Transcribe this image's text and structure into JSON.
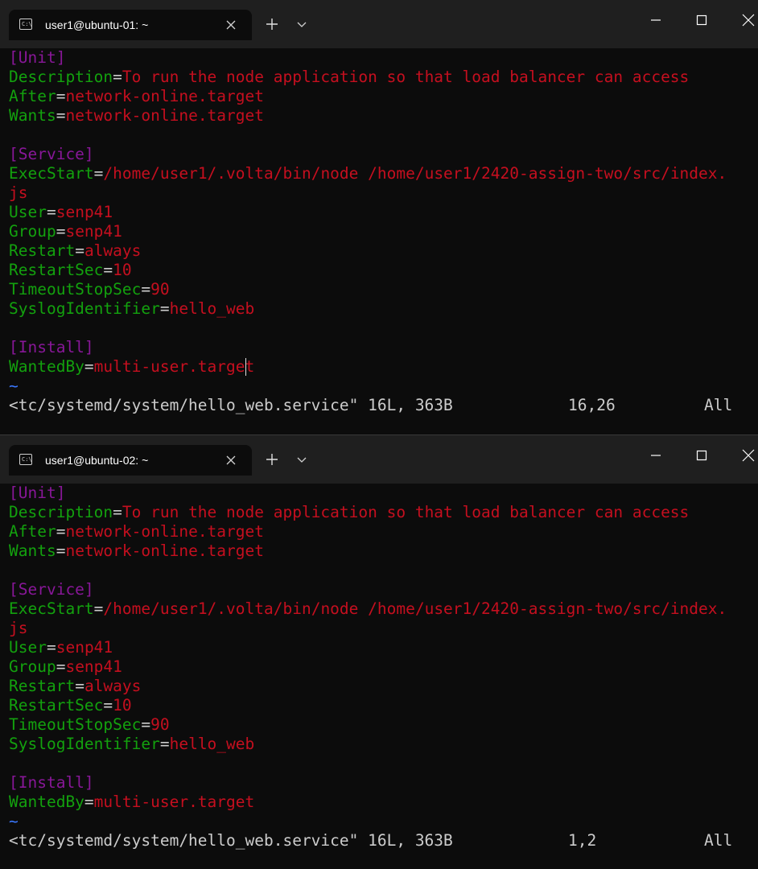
{
  "windows": [
    {
      "tab_title": "user1@ubuntu-01: ~",
      "lines": [
        [
          [
            "sec",
            "[Unit]"
          ]
        ],
        [
          [
            "key",
            "Description"
          ],
          [
            "eq",
            "="
          ],
          [
            "val",
            "To run the node application so that load balancer can access"
          ]
        ],
        [
          [
            "key",
            "After"
          ],
          [
            "eq",
            "="
          ],
          [
            "val",
            "network-online.target"
          ]
        ],
        [
          [
            "key",
            "Wants"
          ],
          [
            "eq",
            "="
          ],
          [
            "val",
            "network-online.target"
          ]
        ],
        [],
        [
          [
            "sec",
            "[Service]"
          ]
        ],
        [
          [
            "key",
            "ExecStart"
          ],
          [
            "eq",
            "="
          ],
          [
            "val",
            "/home/user1/.volta/bin/node /home/user1/2420-assign-two/src/index."
          ]
        ],
        [
          [
            "val",
            "js"
          ]
        ],
        [
          [
            "key",
            "User"
          ],
          [
            "eq",
            "="
          ],
          [
            "val",
            "senp41"
          ]
        ],
        [
          [
            "key",
            "Group"
          ],
          [
            "eq",
            "="
          ],
          [
            "val",
            "senp41"
          ]
        ],
        [
          [
            "key",
            "Restart"
          ],
          [
            "eq",
            "="
          ],
          [
            "val",
            "always"
          ]
        ],
        [
          [
            "key",
            "RestartSec"
          ],
          [
            "eq",
            "="
          ],
          [
            "val",
            "10"
          ]
        ],
        [
          [
            "key",
            "TimeoutStopSec"
          ],
          [
            "eq",
            "="
          ],
          [
            "val",
            "90"
          ]
        ],
        [
          [
            "key",
            "SyslogIdentifier"
          ],
          [
            "eq",
            "="
          ],
          [
            "val",
            "hello_web"
          ]
        ],
        [],
        [
          [
            "sec",
            "[Install]"
          ]
        ],
        [
          [
            "key",
            "WantedBy"
          ],
          [
            "eq",
            "="
          ],
          [
            "val",
            "multi-user.target"
          ]
        ],
        [
          [
            "tilde",
            "~"
          ]
        ]
      ],
      "status": {
        "file": "<tc/systemd/system/hello_web.service\" 16L, 363B",
        "position": "16,26",
        "percent": "All"
      }
    },
    {
      "tab_title": "user1@ubuntu-02: ~",
      "lines": [
        [
          [
            "sec",
            "[Unit]"
          ]
        ],
        [
          [
            "key",
            "Description"
          ],
          [
            "eq",
            "="
          ],
          [
            "val",
            "To run the node application so that load balancer can access"
          ]
        ],
        [
          [
            "key",
            "After"
          ],
          [
            "eq",
            "="
          ],
          [
            "val",
            "network-online.target"
          ]
        ],
        [
          [
            "key",
            "Wants"
          ],
          [
            "eq",
            "="
          ],
          [
            "val",
            "network-online.target"
          ]
        ],
        [],
        [
          [
            "sec",
            "[Service]"
          ]
        ],
        [
          [
            "key",
            "ExecStart"
          ],
          [
            "eq",
            "="
          ],
          [
            "val",
            "/home/user1/.volta/bin/node /home/user1/2420-assign-two/src/index."
          ]
        ],
        [
          [
            "val",
            "js"
          ]
        ],
        [
          [
            "key",
            "User"
          ],
          [
            "eq",
            "="
          ],
          [
            "val",
            "senp41"
          ]
        ],
        [
          [
            "key",
            "Group"
          ],
          [
            "eq",
            "="
          ],
          [
            "val",
            "senp41"
          ]
        ],
        [
          [
            "key",
            "Restart"
          ],
          [
            "eq",
            "="
          ],
          [
            "val",
            "always"
          ]
        ],
        [
          [
            "key",
            "RestartSec"
          ],
          [
            "eq",
            "="
          ],
          [
            "val",
            "10"
          ]
        ],
        [
          [
            "key",
            "TimeoutStopSec"
          ],
          [
            "eq",
            "="
          ],
          [
            "val",
            "90"
          ]
        ],
        [
          [
            "key",
            "SyslogIdentifier"
          ],
          [
            "eq",
            "="
          ],
          [
            "val",
            "hello_web"
          ]
        ],
        [],
        [
          [
            "sec",
            "[Install]"
          ]
        ],
        [
          [
            "key",
            "WantedBy"
          ],
          [
            "eq",
            "="
          ],
          [
            "val",
            "multi-user.target"
          ]
        ],
        [
          [
            "tilde",
            "~"
          ]
        ]
      ],
      "status": {
        "file": "<tc/systemd/system/hello_web.service\" 16L, 363B",
        "position": "1,2",
        "percent": "All"
      }
    }
  ],
  "colors": {
    "section": "#881798",
    "key": "#13a10e",
    "value": "#c50f1f",
    "tilde": "#3b78ff",
    "default": "#cccccc"
  }
}
